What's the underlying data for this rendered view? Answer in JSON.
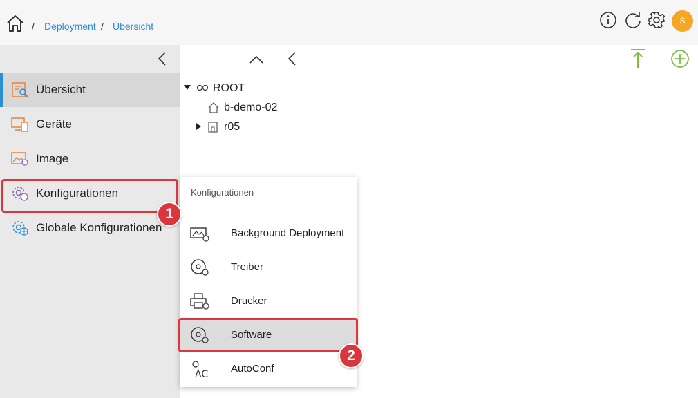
{
  "header": {
    "breadcrumb": [
      {
        "label": "Deployment"
      },
      {
        "label": "Übersicht"
      }
    ],
    "separator": "/",
    "avatar_initial": "S"
  },
  "sidebar": {
    "items": [
      {
        "label": "Übersicht",
        "icon": "overview-icon",
        "active": true
      },
      {
        "label": "Geräte",
        "icon": "devices-icon"
      },
      {
        "label": "Image",
        "icon": "image-icon"
      },
      {
        "label": "Konfigurationen",
        "icon": "config-gear-icon"
      },
      {
        "label": "Globale Konfigurationen",
        "icon": "global-config-icon"
      }
    ]
  },
  "tree": {
    "nodes": [
      {
        "label": "ROOT",
        "icon": "root-icon",
        "expanded": true
      },
      {
        "label": "b-demo-02",
        "icon": "house-icon"
      },
      {
        "label": "r05",
        "icon": "room-icon",
        "expanded": false
      }
    ]
  },
  "popup": {
    "title": "Konfigurationen",
    "items": [
      {
        "label": "Background Deployment",
        "icon": "background-deployment-icon"
      },
      {
        "label": "Treiber",
        "icon": "driver-disc-icon"
      },
      {
        "label": "Drucker",
        "icon": "printer-icon"
      },
      {
        "label": "Software",
        "icon": "software-disc-icon",
        "highlighted": true
      },
      {
        "label": "AutoConf",
        "icon": "autoconf-icon"
      }
    ]
  },
  "annotations": {
    "step1": "1",
    "step2": "2"
  },
  "colors": {
    "accent_blue": "#2a8fd6",
    "accent_green": "#7ac143",
    "callout_red": "#d9363e",
    "avatar_orange": "#f5a623",
    "icon_orange": "#e8823a",
    "icon_purple": "#8e5fb0"
  }
}
